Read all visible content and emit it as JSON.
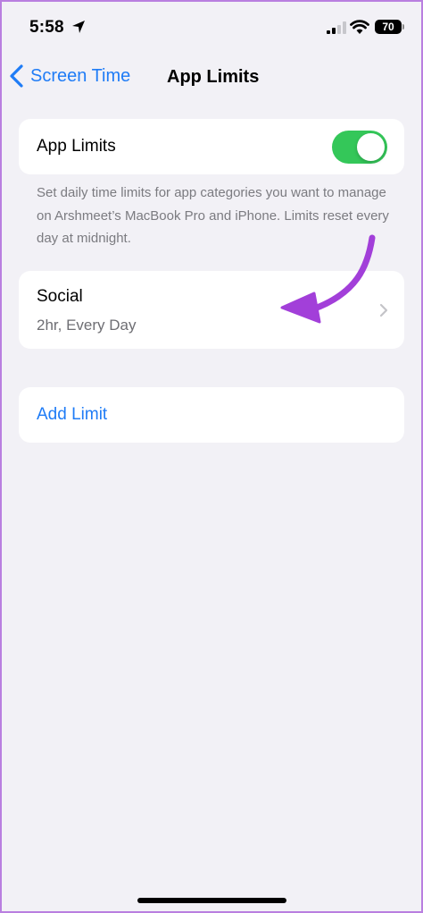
{
  "status_bar": {
    "time": "5:58",
    "battery": "70"
  },
  "nav": {
    "back_label": "Screen Time",
    "title": "App Limits"
  },
  "app_limits_toggle": {
    "label": "App Limits",
    "enabled": true
  },
  "footer_text": "Set daily time limits for app categories you want to manage on Arshmeet’s MacBook Pro and iPhone. Limits reset every day at midnight.",
  "limits": [
    {
      "title": "Social",
      "subtitle": "2hr, Every Day"
    }
  ],
  "add_limit_label": "Add Limit",
  "colors": {
    "accent": "#1f7cf6",
    "toggle_on": "#34c759",
    "annotation": "#a23fd9",
    "background": "#f2f1f6"
  }
}
